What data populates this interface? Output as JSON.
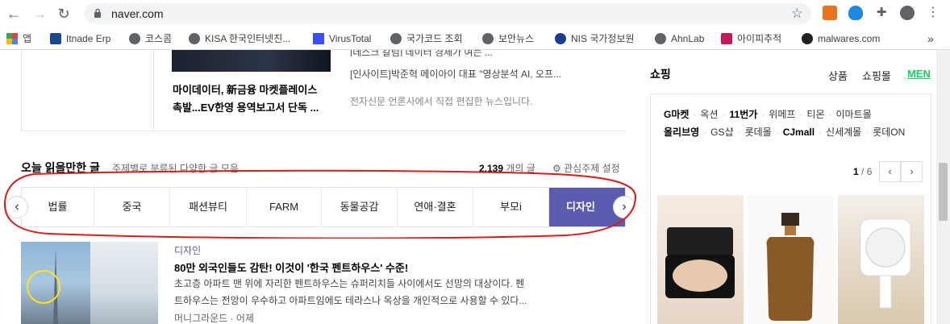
{
  "browser": {
    "url": "naver.com",
    "bookmarks": [
      {
        "label": "앱",
        "color": "#e34133"
      },
      {
        "label": "Itnade Erp",
        "color": "#1a4a8a"
      },
      {
        "label": "코스콤",
        "color": "#5f6368"
      },
      {
        "label": "KISA 한국인터넷진...",
        "color": "#5f6368"
      },
      {
        "label": "VirusTotal",
        "color": "#394eff"
      },
      {
        "label": "국가코드 조회",
        "color": "#5f6368"
      },
      {
        "label": "보안뉴스",
        "color": "#5f6368"
      },
      {
        "label": "NIS 국가정보원",
        "color": "#1b3d8f"
      },
      {
        "label": "AhnLab",
        "color": "#5f6368"
      },
      {
        "label": "아이피추적",
        "color": "#c2185b"
      },
      {
        "label": "malwares.com",
        "color": "#222222"
      }
    ],
    "overflow": "»"
  },
  "news": {
    "headline_line1": "마이데이터, 新금융 마켓플레이스",
    "headline_line2": "촉발...EV한영 용역보고서 단독 ...",
    "side_top": "[인사이트]박준혁 메이아이 대표 \"영상분석 AI, 오프...",
    "side_cut": "[데스크 칼럼] 데이터 경제가 여는 ...",
    "note": "전자신문 언론사에서 직접 편집한 뉴스입니다."
  },
  "reading": {
    "title": "오늘 읽을만한 글",
    "subtitle": "주제별로 분류된 다양한 글 모음",
    "count": "2,139",
    "count_suffix": "개의 글",
    "settings": "관심주제 설정",
    "tabs": [
      "법률",
      "중국",
      "패션뷰티",
      "FARM",
      "동물공감",
      "연애·결혼",
      "부모i",
      "디자인"
    ],
    "active_tab": "디자인",
    "prev": "‹",
    "next": "›"
  },
  "article": {
    "category": "디자인",
    "title": "80만 외국인들도 감탄! 이것이 '한국 펜트하우스' 수준!",
    "desc_line1": "초고층 아파트 맨 위에 자리한 펜트하우스는 슈퍼리치들 사이에서도 선망의 대상이다. 펜",
    "desc_line2": "트하우스는 전망이 우수하고 아파트임에도 테라스나 옥상을 개인적으로 사용할 수 있다...",
    "source": "머니그라운드 · 어제"
  },
  "shopping": {
    "title": "쇼핑",
    "tabs": [
      "상품",
      "쇼핑몰",
      "MEN"
    ],
    "row1": [
      "G마켓",
      "옥션",
      "11번가",
      "위메프",
      "티몬",
      "이마트몰"
    ],
    "row2": [
      "올리브영",
      "GS샵",
      "롯데몰",
      "CJmall",
      "신세계몰",
      "롯데ON"
    ],
    "page_current": "1",
    "page_total": "/ 6",
    "prev": "‹",
    "next": "›"
  }
}
